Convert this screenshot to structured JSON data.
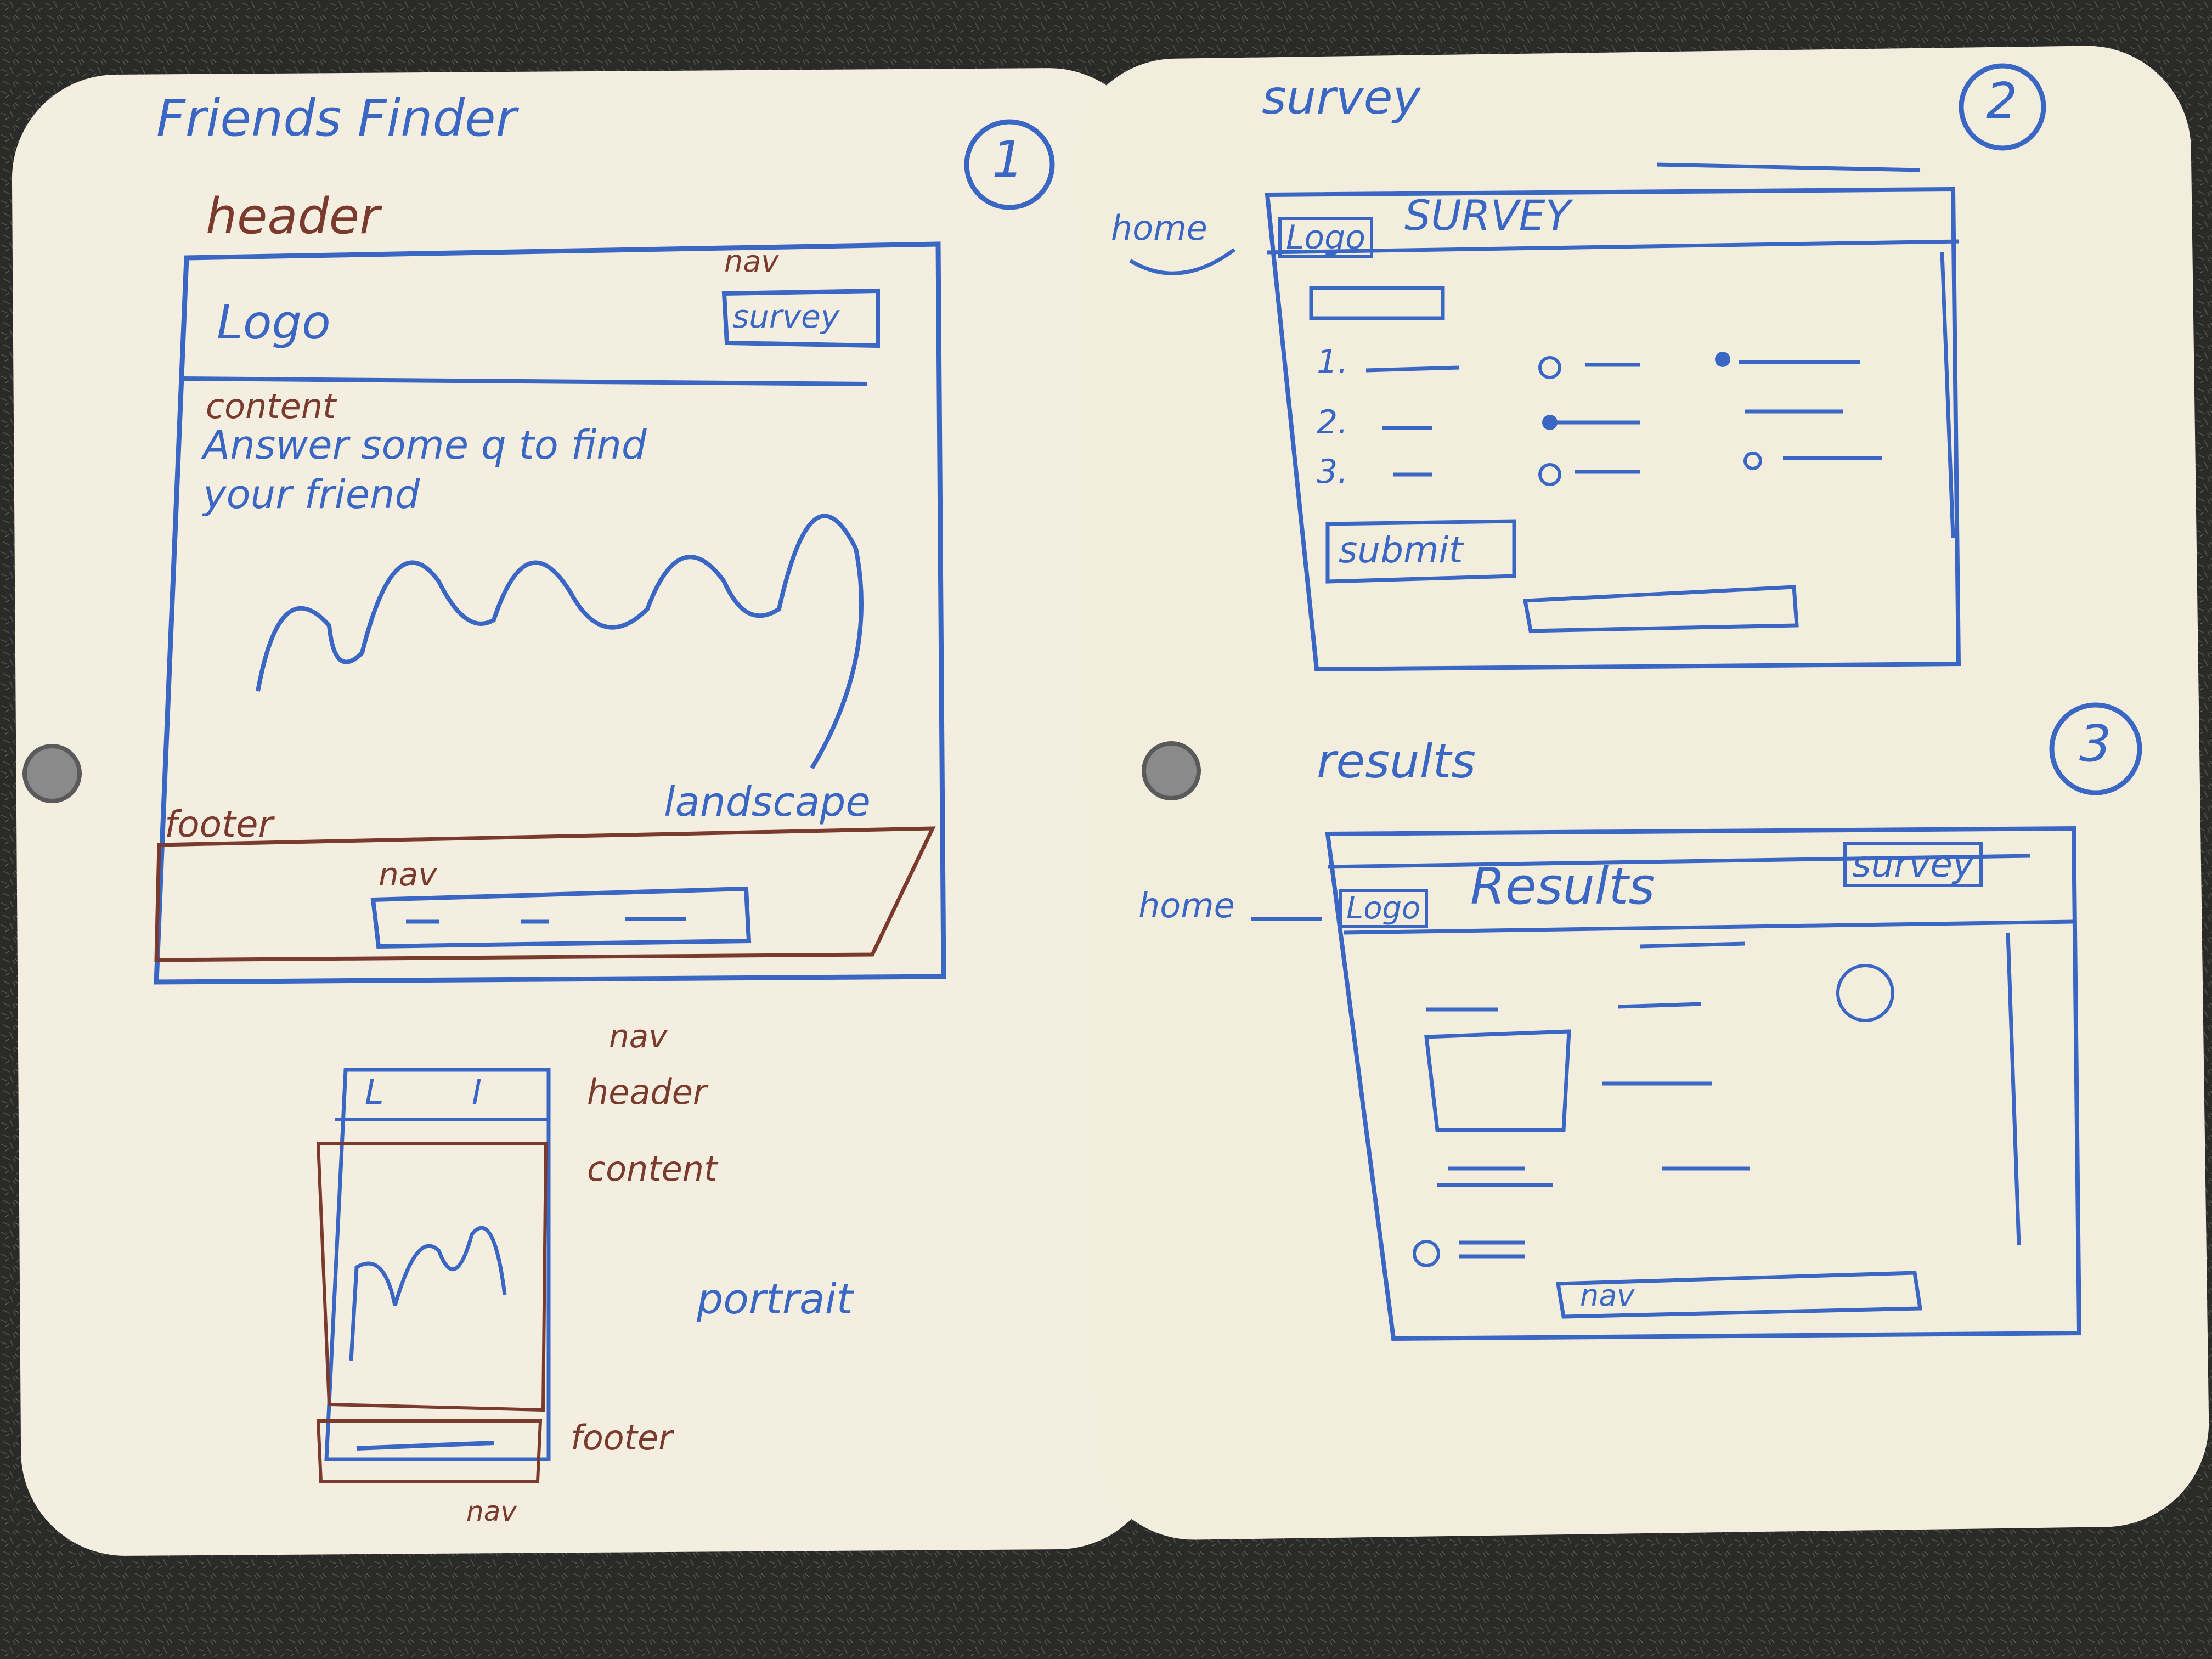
{
  "colors": {
    "carpet": "#2a2a28",
    "board": "#f3eedf",
    "marker_blue": "#3b67c4",
    "marker_brown": "#7a3b2e",
    "snap": "#8a8a8a"
  },
  "board1": {
    "title": "Friends Finder",
    "number": "1",
    "header_label": "header",
    "nav_label": "nav",
    "logo": "Logo",
    "survey_button": "survey",
    "content_label": "content",
    "content_text_line1": "Answer some q to find",
    "content_text_line2": "your friend",
    "footer_label": "footer",
    "footer_nav_label": "nav",
    "landscape_label": "landscape",
    "mobile": {
      "header_logo": "L",
      "header_menu": "I",
      "nav_label": "nav",
      "header_label": "header",
      "content_label": "content",
      "footer_label": "footer",
      "footer_nav_label": "nav",
      "portrait_label": "portrait"
    }
  },
  "board2": {
    "title": "survey",
    "number": "2",
    "home_label": "home",
    "logo": "Logo",
    "page_title": "SURVEY",
    "questions": [
      "1.",
      "2.",
      "3."
    ],
    "submit_button": "submit"
  },
  "board3": {
    "title": "results",
    "number": "3",
    "home_label": "home",
    "logo": "Logo",
    "page_title": "Results",
    "survey_button": "survey",
    "nav_label": "nav"
  }
}
